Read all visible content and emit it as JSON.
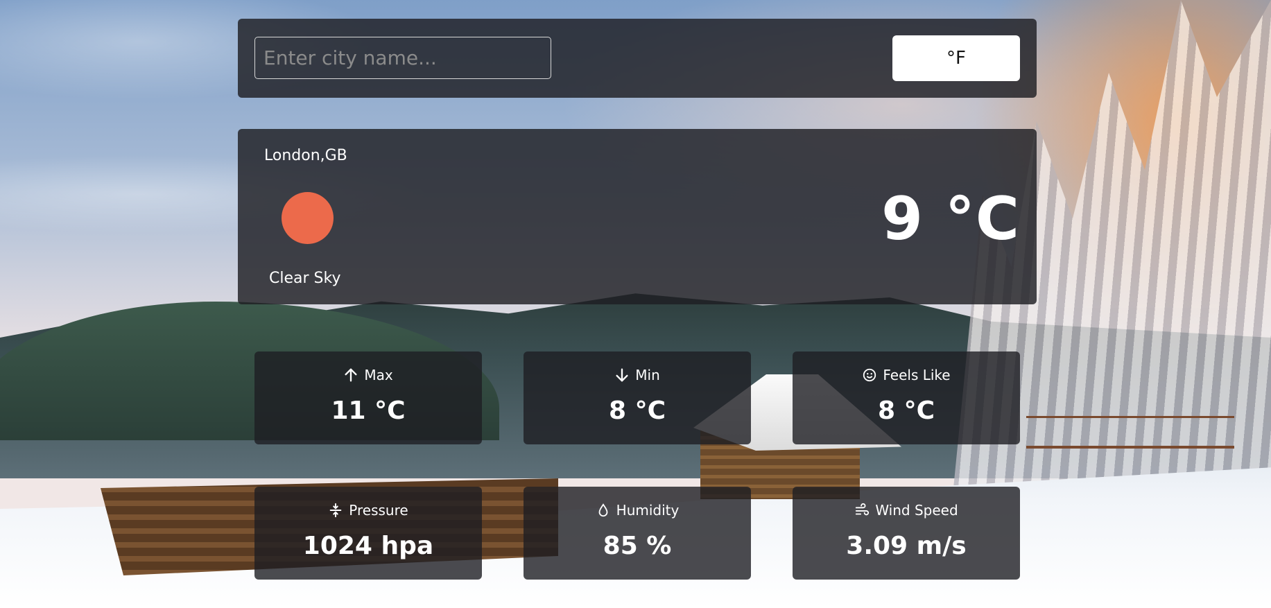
{
  "search": {
    "placeholder": "Enter city name...",
    "unit_toggle_label": "°F"
  },
  "current": {
    "location": "London,GB",
    "description": "Clear Sky",
    "temperature": "9 °C",
    "icon": "sun-icon",
    "icon_color": "#ec6a4b"
  },
  "stats": {
    "max": {
      "label": "Max",
      "value": "11 °C",
      "icon": "arrow-up-icon"
    },
    "min": {
      "label": "Min",
      "value": "8 °C",
      "icon": "arrow-down-icon"
    },
    "feels_like": {
      "label": "Feels Like",
      "value": "8 °C",
      "icon": "smiley-icon"
    },
    "pressure": {
      "label": "Pressure",
      "value": "1024 hpa",
      "icon": "pressure-icon"
    },
    "humidity": {
      "label": "Humidity",
      "value": "85 %",
      "icon": "droplet-icon"
    },
    "wind_speed": {
      "label": "Wind Speed",
      "value": "3.09 m/s",
      "icon": "wind-icon"
    }
  },
  "colors": {
    "panel": "#1e1e23",
    "accent": "#ec6a4b"
  }
}
